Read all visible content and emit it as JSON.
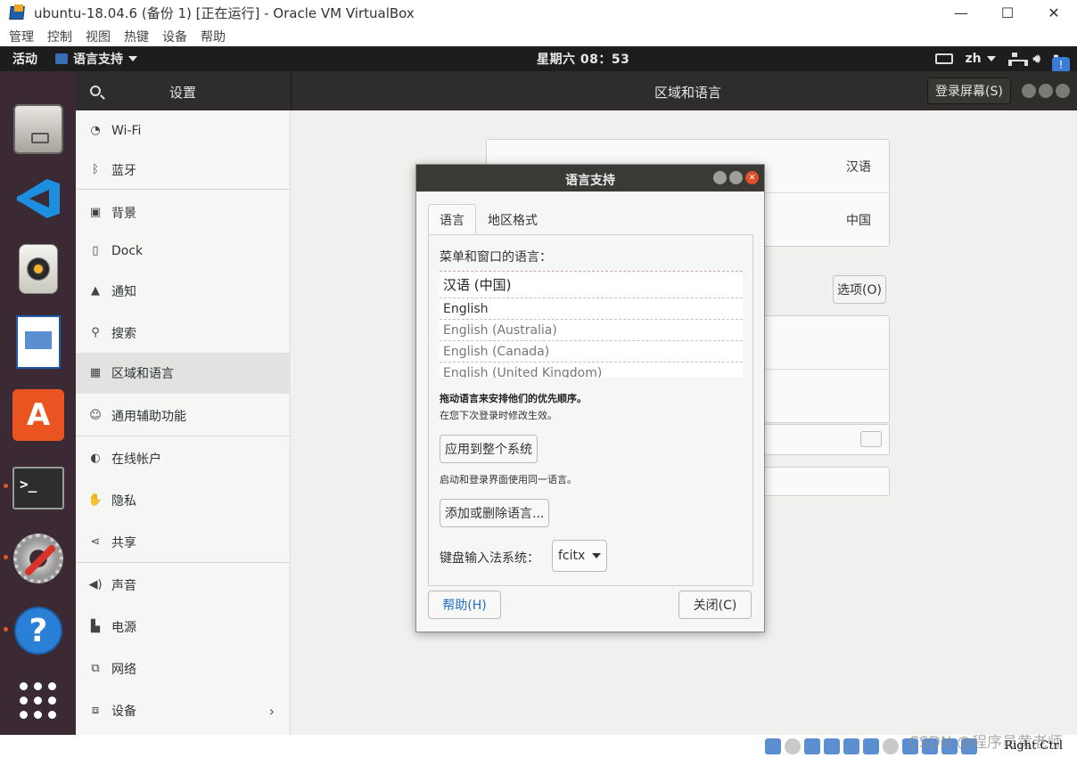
{
  "host": {
    "title": "ubuntu-18.04.6 (备份 1) [正在运行] - Oracle VM VirtualBox",
    "window_buttons": [
      "—",
      "☐",
      "✕"
    ],
    "menu": [
      "管理",
      "控制",
      "视图",
      "热键",
      "设备",
      "帮助"
    ],
    "host_key_label": "Right Ctrl",
    "watermark": "CSDN @程序员黄老师"
  },
  "topbar": {
    "activities": "活动",
    "app_menu": "语言支持",
    "clock": "星期六 08：53",
    "input_method": "zh"
  },
  "dock": {
    "items": [
      "files-icon",
      "vscode-icon",
      "rhythmbox-icon",
      "libreoffice-writer-icon",
      "software-center-icon",
      "terminal-icon",
      "settings-icon",
      "help-icon",
      "show-apps-icon"
    ],
    "store_glyph": "A",
    "help_glyph": "?",
    "terminal_glyph": ">_"
  },
  "settings": {
    "sidebar_title": "设置",
    "panel_title": "区域和语言",
    "login_screen_button": "登录屏幕(S)",
    "sidebar_items": [
      {
        "label": "Wi-Fi",
        "icon": "wifi-icon"
      },
      {
        "label": "蓝牙",
        "icon": "bluetooth-icon"
      },
      {
        "label": "背景",
        "icon": "background-icon"
      },
      {
        "label": "Dock",
        "icon": "dock-icon"
      },
      {
        "label": "通知",
        "icon": "bell-icon"
      },
      {
        "label": "搜索",
        "icon": "search-icon"
      },
      {
        "label": "区域和语言",
        "icon": "region-icon"
      },
      {
        "label": "通用辅助功能",
        "icon": "accessibility-icon"
      },
      {
        "label": "在线帐户",
        "icon": "online-accounts-icon"
      },
      {
        "label": "隐私",
        "icon": "hand-icon"
      },
      {
        "label": "共享",
        "icon": "share-icon"
      },
      {
        "label": "声音",
        "icon": "speaker-icon"
      },
      {
        "label": "电源",
        "icon": "power-icon"
      },
      {
        "label": "网络",
        "icon": "network-icon"
      },
      {
        "label": "设备",
        "icon": "devices-icon"
      }
    ],
    "selected_item": "区域和语言",
    "language_value": "汉语",
    "formats_value": "中国",
    "options_button": "选项(O)"
  },
  "dialog": {
    "title": "语言支持",
    "tabs": [
      "语言",
      "地区格式"
    ],
    "menu_language_label": "菜单和窗口的语言：",
    "languages": [
      "汉语 (中国)",
      "English",
      "English (Australia)",
      "English (Canada)",
      "English (United Kingdom)"
    ],
    "drag_hint": "拖动语言来安排他们的优先顺序。",
    "effect_hint": "在您下次登录时修改生效。",
    "apply_button": "应用到整个系统",
    "apply_hint": "启动和登录界面使用同一语言。",
    "add_remove_button": "添加或删除语言...",
    "im_label": "键盘输入法系统：",
    "im_value": "fcitx",
    "help_button": "帮助(H)",
    "close_button": "关闭(C)"
  }
}
